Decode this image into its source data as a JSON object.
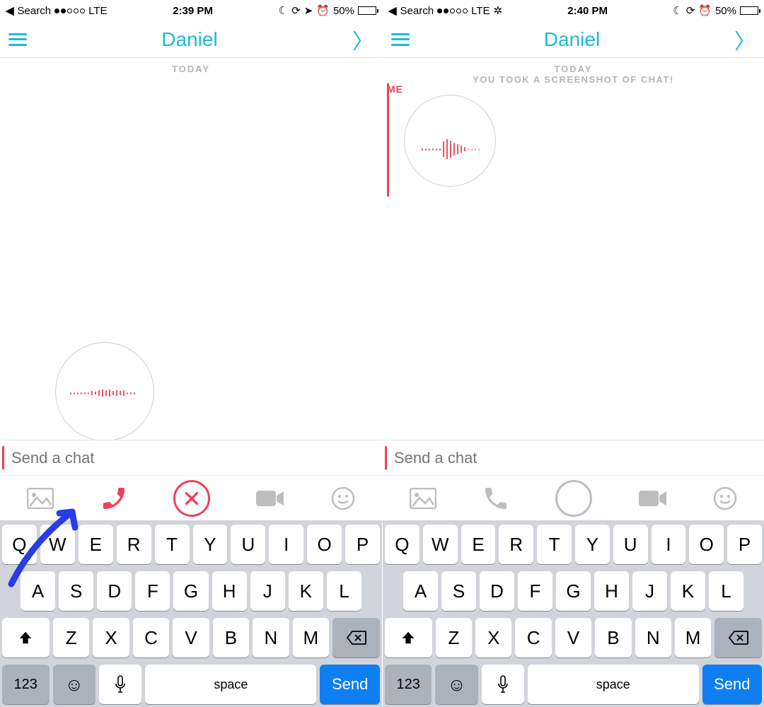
{
  "left": {
    "status": {
      "search": "Search",
      "carrier": "LTE",
      "time": "2:39 PM",
      "battery_pct": "50%",
      "battery_level": 50,
      "signal_filled": 2,
      "signal_total": 5,
      "icons": [
        "moon",
        "lock",
        "location",
        "alarm"
      ]
    },
    "header": {
      "title": "Daniel"
    },
    "chat": {
      "date_label": "TODAY"
    },
    "input": {
      "placeholder": "Send a chat"
    },
    "toolbar": {
      "items": [
        "gallery",
        "phone",
        "cancel",
        "video",
        "sticker"
      ],
      "active_color": "red"
    },
    "keyboard": {
      "row1": [
        "Q",
        "W",
        "E",
        "R",
        "T",
        "Y",
        "U",
        "I",
        "O",
        "P"
      ],
      "row2": [
        "A",
        "S",
        "D",
        "F",
        "G",
        "H",
        "J",
        "K",
        "L"
      ],
      "row3": [
        "Z",
        "X",
        "C",
        "V",
        "B",
        "N",
        "M"
      ],
      "numkey": "123",
      "space": "space",
      "send": "Send"
    }
  },
  "right": {
    "status": {
      "search": "Search",
      "carrier": "LTE",
      "time": "2:40 PM",
      "battery_pct": "50%",
      "battery_level": 50,
      "signal_filled": 2,
      "signal_total": 5,
      "icons": [
        "moon",
        "lock",
        "alarm"
      ],
      "loading": true
    },
    "header": {
      "title": "Daniel"
    },
    "chat": {
      "date_label": "TODAY",
      "sub_label": "YOU TOOK A SCREENSHOT OF CHAT!",
      "me_label": "ME"
    },
    "input": {
      "placeholder": "Send a chat"
    },
    "toolbar": {
      "items": [
        "gallery",
        "phone",
        "record",
        "video",
        "sticker"
      ],
      "active_color": "grey"
    },
    "keyboard": {
      "row1": [
        "Q",
        "W",
        "E",
        "R",
        "T",
        "Y",
        "U",
        "I",
        "O",
        "P"
      ],
      "row2": [
        "A",
        "S",
        "D",
        "F",
        "G",
        "H",
        "J",
        "K",
        "L"
      ],
      "row3": [
        "Z",
        "X",
        "C",
        "V",
        "B",
        "N",
        "M"
      ],
      "numkey": "123",
      "space": "space",
      "send": "Send"
    }
  }
}
